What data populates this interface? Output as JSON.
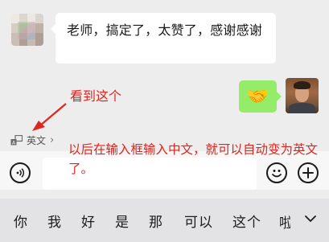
{
  "chat": {
    "incoming_message": "老师，搞定了，太赞了，感谢感谢",
    "outgoing_emoji": "🤝"
  },
  "annotations": {
    "top_note": "看到这个",
    "bottom_note": "以后在输入框输入中文，就可以自动变为英文了。"
  },
  "translate_toggle": {
    "label": "英文",
    "chevron": "›"
  },
  "input": {
    "value": ""
  },
  "keyboard": {
    "candidates": [
      "你",
      "我",
      "好",
      "是",
      "那",
      "可以",
      "这个"
    ],
    "partial_candidate": "啦"
  },
  "colors": {
    "annotation_red": "#e0251e",
    "sent_bubble": "#95ec69",
    "chat_background": "#ededed"
  }
}
